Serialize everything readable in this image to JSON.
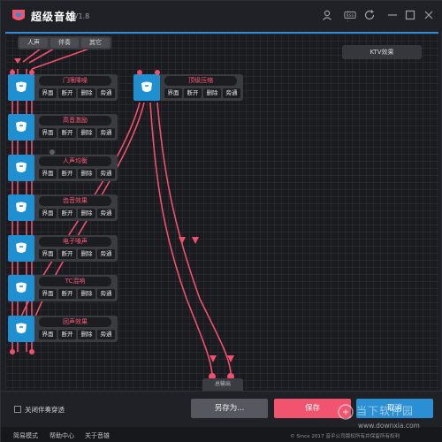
{
  "app": {
    "title": "超级音雄",
    "version": "V1.8"
  },
  "titlebar": {
    "icons": [
      "user-icon",
      "rss-icon",
      "refresh-icon",
      "minimize-icon",
      "close-icon"
    ]
  },
  "canvas": {
    "inputs": [
      "人声",
      "伴奏",
      "其它"
    ],
    "ktv_label": "KTV效果",
    "output_label": "总输出",
    "nodes": [
      {
        "name": "门限降噪",
        "buttons": [
          "界面",
          "断开",
          "删除",
          "旁通"
        ]
      },
      {
        "name": "高音激励",
        "buttons": [
          "界面",
          "断开",
          "删除",
          "旁通"
        ]
      },
      {
        "name": "人声均衡",
        "buttons": [
          "界面",
          "断开",
          "删除",
          "旁通"
        ]
      },
      {
        "name": "齿音效果",
        "buttons": [
          "界面",
          "断开",
          "删除",
          "旁通"
        ]
      },
      {
        "name": "电子嗓声",
        "buttons": [
          "界面",
          "断开",
          "删除",
          "旁通"
        ]
      },
      {
        "name": "TC混响",
        "buttons": [
          "界面",
          "断开",
          "删除",
          "旁通"
        ]
      },
      {
        "name": "回声效果",
        "buttons": [
          "界面",
          "断开",
          "删除",
          "旁通"
        ]
      },
      {
        "name": "顶级压缩",
        "buttons": [
          "界面",
          "断开",
          "删除",
          "旁通"
        ]
      }
    ]
  },
  "bottom": {
    "checkbox_label": "关闭伴奏穿透",
    "save_as": "另存为...",
    "save": "保存",
    "cancel": "取消"
  },
  "footer": {
    "links": [
      "简易模式",
      "帮助中心",
      "关于音雄"
    ],
    "copyright": "© Since 2017 音乎公司版权所有并保留所有权利"
  },
  "watermark": {
    "text": "当下软件园",
    "url": "www.downxia.com"
  },
  "colors": {
    "accent_pink": "#f0546f",
    "accent_blue": "#2a8fd3",
    "node_icon_blue": "#1e8fd0"
  }
}
